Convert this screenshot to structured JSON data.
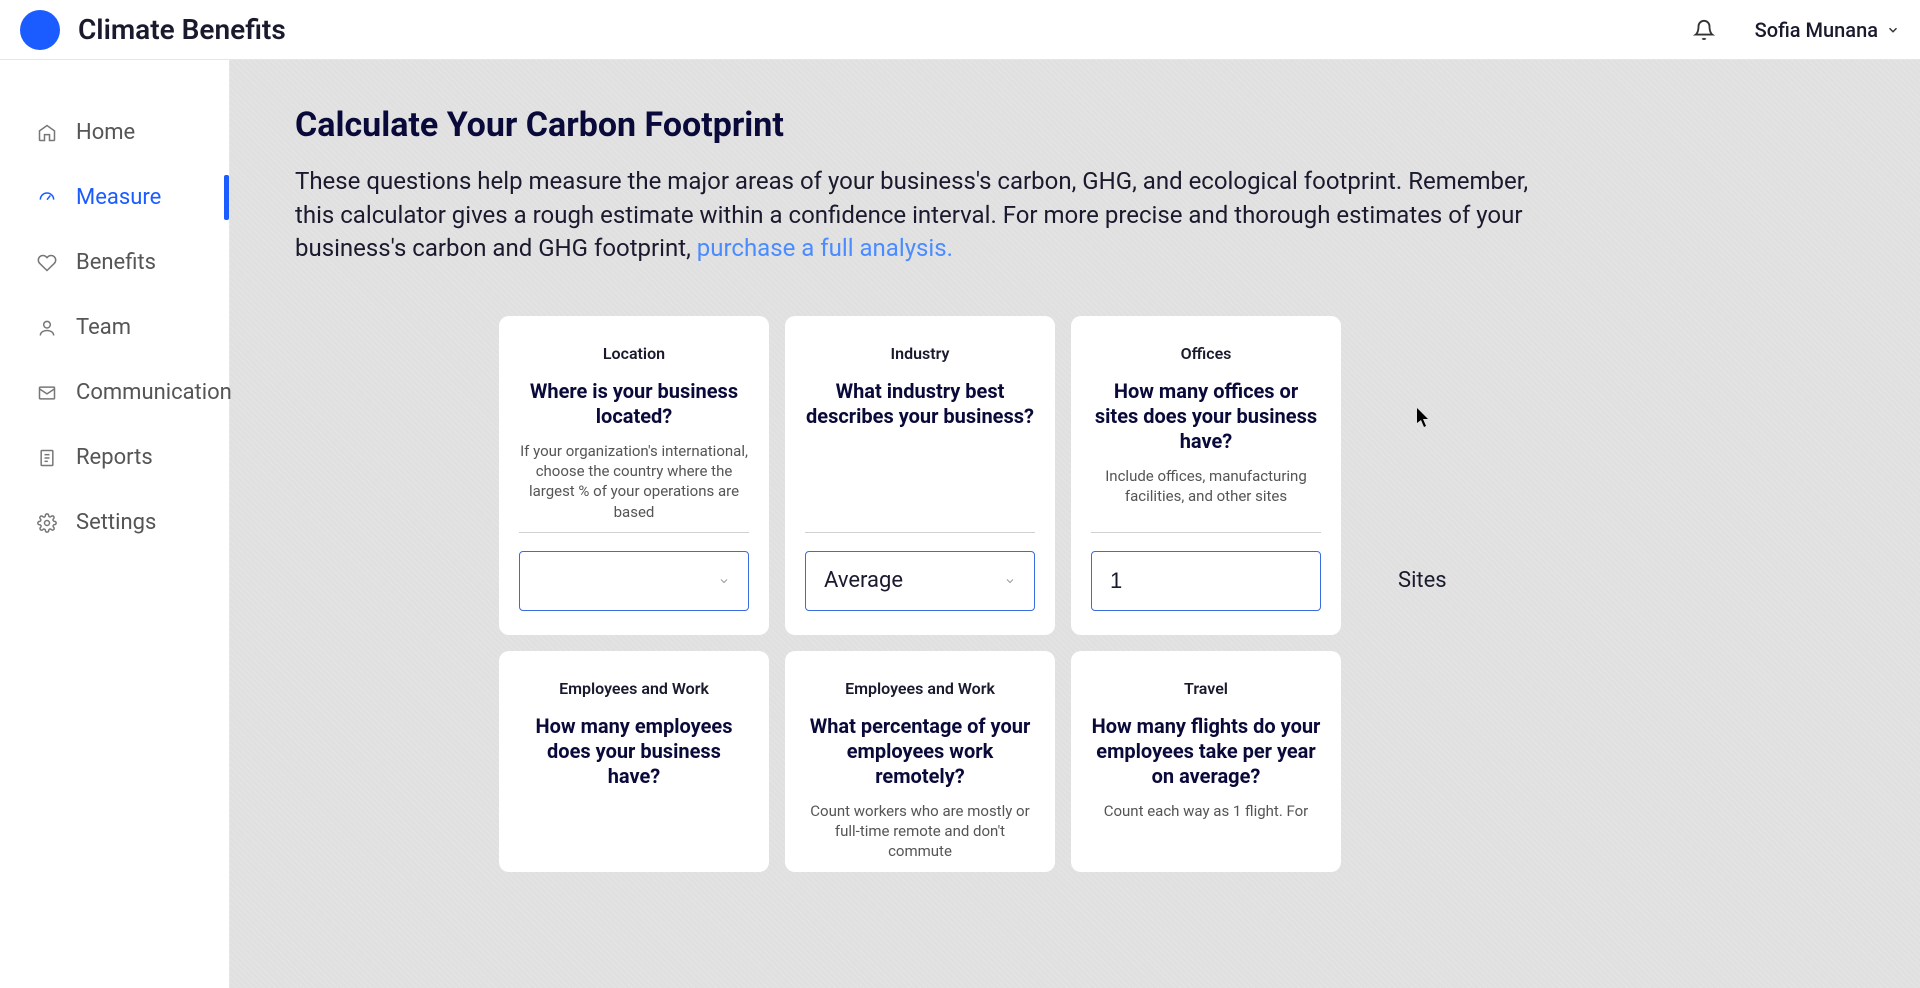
{
  "header": {
    "app_title": "Climate Benefits",
    "user_name": "Sofia Munana"
  },
  "sidebar": {
    "items": [
      {
        "label": "Home"
      },
      {
        "label": "Measure"
      },
      {
        "label": "Benefits"
      },
      {
        "label": "Team"
      },
      {
        "label": "Communication"
      },
      {
        "label": "Reports"
      },
      {
        "label": "Settings"
      }
    ]
  },
  "page": {
    "title": "Calculate Your Carbon Footprint",
    "description_part1": "These questions help measure the major areas of your business's carbon, GHG, and ecological footprint. Remember, this calculator gives a rough estimate within a confidence interval. For more precise and thorough estimates of your business's carbon and GHG footprint, ",
    "description_link": "purchase a full analysis."
  },
  "cards": [
    {
      "category": "Location",
      "question": "Where is your business located?",
      "hint": "If your organization's international, choose the country where the largest % of your operations are based",
      "input_type": "select",
      "value": ""
    },
    {
      "category": "Industry",
      "question": "What industry best describes your business?",
      "hint": "",
      "input_type": "select",
      "value": "Average"
    },
    {
      "category": "Offices",
      "question": "How many offices or sites does your business have?",
      "hint": "Include offices, manufacturing facilities, and other sites",
      "input_type": "number_suffix",
      "value": "1",
      "suffix": "Sites"
    },
    {
      "category": "Employees and Work",
      "question": "How many employees does your business have?",
      "hint": ""
    },
    {
      "category": "Employees and Work",
      "question": "What percentage of your employees work remotely?",
      "hint": "Count workers who are mostly or full-time remote and don't commute"
    },
    {
      "category": "Travel",
      "question": "How many flights do your employees take per year on average?",
      "hint": "Count each way as 1 flight. For"
    }
  ]
}
